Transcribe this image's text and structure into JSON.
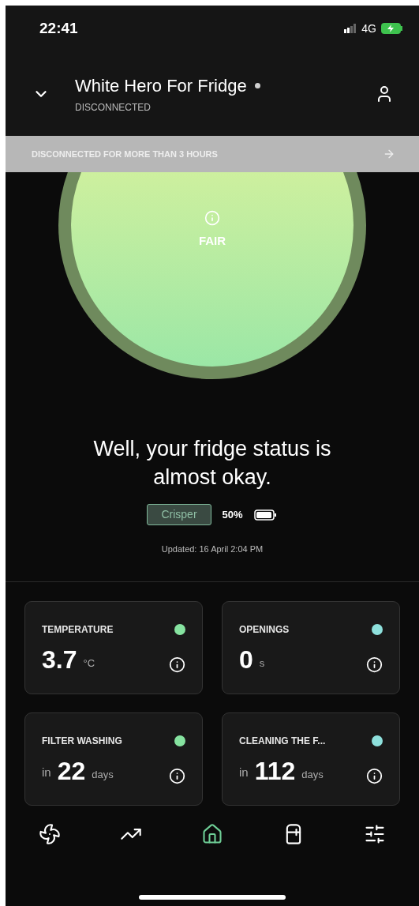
{
  "status_bar": {
    "time": "22:41",
    "network": "4G"
  },
  "header": {
    "title": "White Hero For Fridge",
    "subtitle": "DISCONNECTED",
    "connected": false
  },
  "banner": {
    "text": "DISCONNECTED FOR MORE THAN 3 HOURS"
  },
  "gauge": {
    "label": "FAIR"
  },
  "message": "Well, your fridge status is almost okay.",
  "mode": {
    "label": "Crisper",
    "battery": "50%"
  },
  "updated": "Updated: 16 April 2:04 PM",
  "cards": [
    {
      "title": "TEMPERATURE",
      "value": "3.7",
      "unit": "°C",
      "color": "#86e3a0"
    },
    {
      "title": "OPENINGS",
      "value": "0",
      "unit": "s",
      "color": "#8ee0dc"
    },
    {
      "title": "FILTER WASHING",
      "prefix": "in",
      "value": "22",
      "unit": "days",
      "color": "#86e3a0"
    },
    {
      "title": "CLEANING THE F...",
      "prefix": "in",
      "value": "112",
      "unit": "days",
      "color": "#8ee0dc"
    }
  ],
  "nav": [
    {
      "kind": "fan",
      "selected": false
    },
    {
      "kind": "trend",
      "selected": false
    },
    {
      "kind": "home",
      "selected": true
    },
    {
      "kind": "fridge",
      "selected": false
    },
    {
      "kind": "sliders",
      "selected": false
    }
  ]
}
